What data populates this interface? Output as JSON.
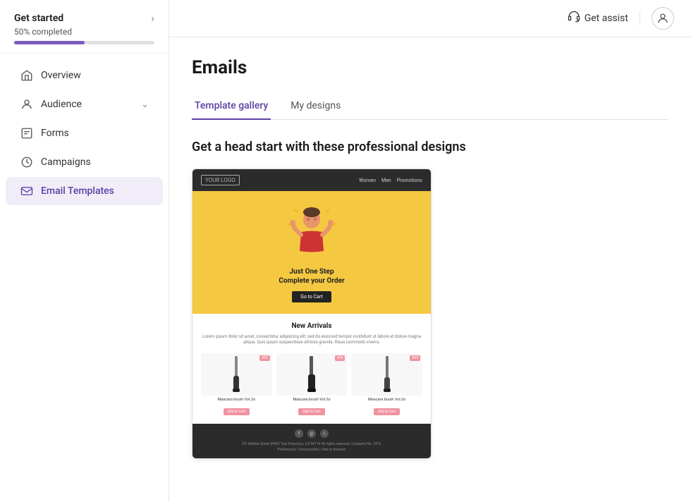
{
  "sidebar": {
    "get_started": {
      "title": "Get started",
      "progress_label": "50% completed",
      "progress_percent": 50
    },
    "nav_items": [
      {
        "id": "overview",
        "label": "Overview",
        "icon": "home-icon",
        "active": false,
        "has_chevron": false
      },
      {
        "id": "audience",
        "label": "Audience",
        "icon": "audience-icon",
        "active": false,
        "has_chevron": true
      },
      {
        "id": "forms",
        "label": "Forms",
        "icon": "forms-icon",
        "active": false,
        "has_chevron": false
      },
      {
        "id": "campaigns",
        "label": "Campaigns",
        "icon": "campaigns-icon",
        "active": false,
        "has_chevron": false
      },
      {
        "id": "email-templates",
        "label": "Email Templates",
        "icon": "email-icon",
        "active": true,
        "has_chevron": false
      }
    ]
  },
  "topbar": {
    "get_assist_label": "Get assist",
    "headset_icon": "headset-icon",
    "user_icon": "user-icon"
  },
  "main": {
    "page_title": "Emails",
    "tabs": [
      {
        "id": "template-gallery",
        "label": "Template gallery",
        "active": true
      },
      {
        "id": "my-designs",
        "label": "My designs",
        "active": false
      }
    ],
    "section_heading": "Get a head start with these professional designs",
    "template": {
      "header": {
        "logo": "YOUR LOGO",
        "nav": [
          "Women",
          "Men",
          "Promotions"
        ]
      },
      "hero": {
        "title": "Just One Step\nComplete your Order",
        "button": "Go to Cart"
      },
      "new_arrivals": {
        "title": "New Arrivals",
        "description": "Lorem ipsum dolor sit amet, consectetur adipiscing elit, sed do eiusmod tempor incididunt ut labore et dolore magna aliqua. Quis ipsum suspendisse ultrices gravida. Risus commodo viverra.",
        "products": [
          {
            "name": "Mascara brush Vol.2o",
            "badge": "#35",
            "button": "Add to Cart"
          },
          {
            "name": "Mascara brush Vol.2o",
            "badge": "#35",
            "button": "Add to Cart"
          },
          {
            "name": "Mascara brush Vol.2o",
            "badge": "#35",
            "button": "Add to Cart"
          }
        ]
      },
      "footer": {
        "social_icons": [
          "f",
          "p",
          "i"
        ],
        "address": "231 Market Street #4567 San Francisco, CA 94114 All rights reserved, Company No. 34Ts.",
        "links": "Preferences | Unsubscribe | View in browser"
      }
    }
  }
}
